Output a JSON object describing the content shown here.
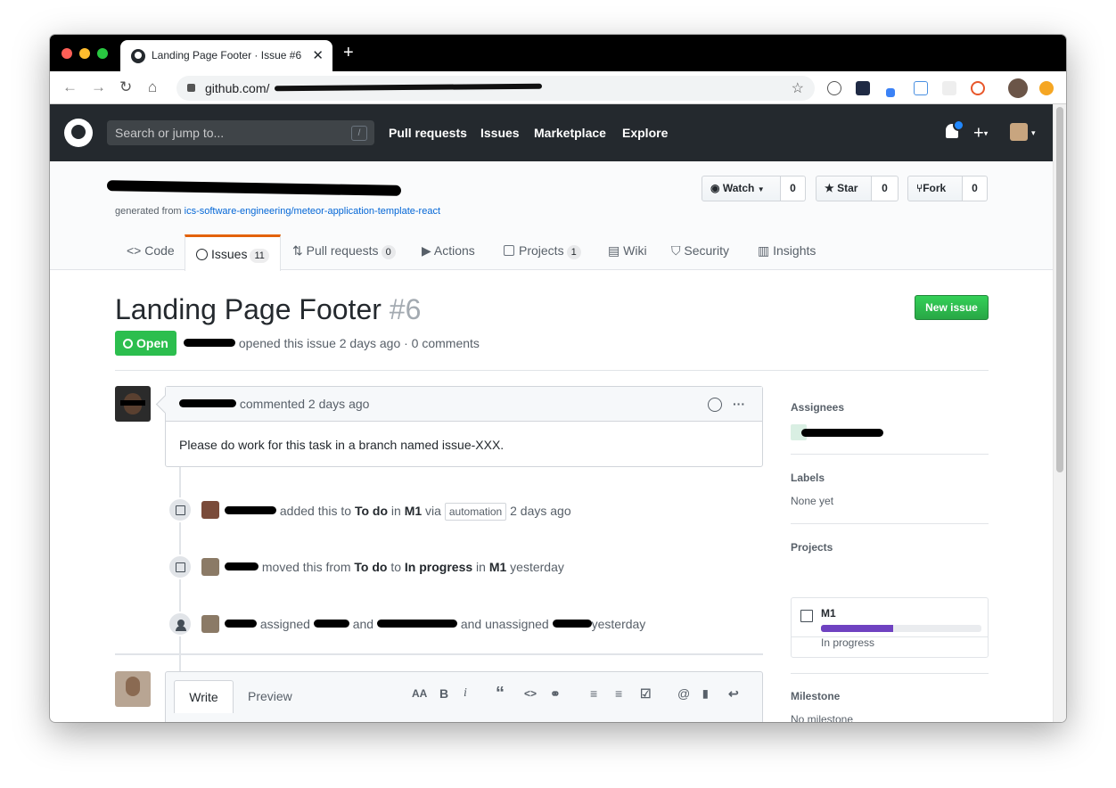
{
  "browser": {
    "tab_title": "Landing Page Footer · Issue #6",
    "tab_close": "✕",
    "new_tab": "+",
    "url": "github.com/",
    "icons": [
      "back-icon",
      "forward-icon",
      "reload-icon",
      "home-icon",
      "lock-icon",
      "star-icon"
    ]
  },
  "header": {
    "search_placeholder": "Search or jump to...",
    "search_key": "/",
    "nav": [
      "Pull requests",
      "Issues",
      "Marketplace",
      "Explore"
    ],
    "plus": "+",
    "caret": "▾"
  },
  "repo": {
    "generated_prefix": "generated from ",
    "template_link": "ics-software-engineering/meteor-application-template-react",
    "watch_label": "Watch",
    "watch_count": "0",
    "star_label": "Star",
    "star_count": "0",
    "fork_label": "Fork",
    "fork_count": "0",
    "tabs": [
      {
        "label": "Code",
        "count": ""
      },
      {
        "label": "Issues",
        "count": "11"
      },
      {
        "label": "Pull requests",
        "count": "0"
      },
      {
        "label": "Actions",
        "count": ""
      },
      {
        "label": "Projects",
        "count": "1"
      },
      {
        "label": "Wiki",
        "count": ""
      },
      {
        "label": "Security",
        "count": ""
      },
      {
        "label": "Insights",
        "count": ""
      }
    ]
  },
  "issue": {
    "title": "Landing Page Footer",
    "number": "#6",
    "new_issue_label": "New issue",
    "state": "Open",
    "meta_text": "opened this issue 2 days ago · 0 comments",
    "comment_header": "commented 2 days ago",
    "comment_body": "Please do work for this task in a branch named issue-XXX.",
    "more": "···"
  },
  "timeline": [
    {
      "pre": "added this to ",
      "col": "To do",
      "mid": " in ",
      "proj": "M1",
      "post": " via ",
      "badge": "automation",
      "time": " 2 days ago"
    },
    {
      "pre": "moved this from ",
      "col": "To do",
      "mid": " to ",
      "col2": "In progress",
      "mid2": " in ",
      "proj": "M1",
      "time": " yesterday"
    },
    {
      "pre": "assigned ",
      "mid": " and ",
      "post": " and unassigned ",
      "time": "yesterday"
    }
  ],
  "composer": {
    "write_tab": "Write",
    "preview_tab": "Preview",
    "tools": [
      "AA",
      "B",
      "i",
      "“",
      "<>",
      "⚭",
      "≡",
      "≡",
      "☑",
      "@",
      "🔖",
      "↩"
    ]
  },
  "sidebar": {
    "assignees_heading": "Assignees",
    "labels_heading": "Labels",
    "labels_value": "None yet",
    "projects_heading": "Projects",
    "project_name": "M1",
    "project_status": "In progress",
    "project_progress": 0.45,
    "milestone_heading": "Milestone",
    "milestone_value": "No milestone"
  },
  "colors": {
    "header_bg": "#24292e",
    "open_green": "#2cbe4e",
    "tab_accent": "#e36209",
    "link_blue": "#0366d6",
    "progress_purple": "#6f42c1"
  }
}
